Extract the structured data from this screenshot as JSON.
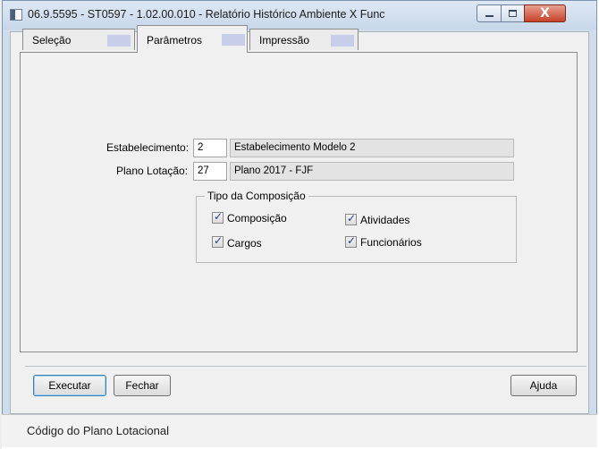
{
  "window": {
    "title": "06.9.5595 - ST0597 - 1.02.00.010 - Relatório Histórico Ambiente X Func",
    "close_glyph": "X"
  },
  "tabs": [
    {
      "label": "Seleção",
      "active": false
    },
    {
      "label": "Parâmetros",
      "active": true
    },
    {
      "label": "Impressão",
      "active": false
    }
  ],
  "fields": {
    "estabelecimento": {
      "label": "Estabelecimento:",
      "value": "2",
      "description": "Estabelecimento Modelo 2"
    },
    "plano_lotacao": {
      "label": "Plano Lotação:",
      "value": "27",
      "description": "Plano 2017 - FJF"
    }
  },
  "composicao": {
    "title": "Tipo da Composição",
    "options": [
      {
        "label": "Composição",
        "checked": true
      },
      {
        "label": "Atividades",
        "checked": true
      },
      {
        "label": "Cargos",
        "checked": true
      },
      {
        "label": "Funcionários",
        "checked": true
      }
    ]
  },
  "buttons": {
    "executar": "Executar",
    "fechar": "Fechar",
    "ajuda": "Ajuda"
  },
  "status": {
    "text": "Código do Plano Lotacional"
  },
  "icons": {
    "check": "✓",
    "app": "window-icon",
    "minimize": "minimize-icon",
    "maximize": "maximize-icon",
    "close": "close-icon"
  },
  "colors": {
    "frame": "#cfdcea",
    "tab_bar": "#c8cee9",
    "close_button": "#c7422a"
  }
}
